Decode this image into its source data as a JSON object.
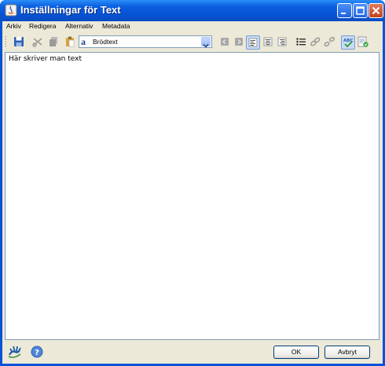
{
  "window": {
    "title": "Inställningar för Text"
  },
  "menu": [
    "Arkiv",
    "Redigera",
    "Alternativ",
    "Metadata"
  ],
  "toolbar": {
    "style_value": "Brödtext"
  },
  "editor": {
    "text": "Här skriver man text"
  },
  "buttons": {
    "ok": "OK",
    "cancel": "Avbryt"
  },
  "icons": [
    "save-icon",
    "cut-icon",
    "copy-icon",
    "paste-icon",
    "style-icon",
    "chevron-down-icon",
    "indent-decrease-icon",
    "indent-increase-icon",
    "align-left-icon",
    "align-center-icon",
    "align-right-icon",
    "bullet-list-icon",
    "link-icon",
    "unlink-icon",
    "spellcheck-icon",
    "spellcheck-options-icon",
    "hand-logo-icon",
    "help-icon",
    "minimize-icon",
    "maximize-icon",
    "close-icon"
  ],
  "colors": {
    "titlebar": "#0654d4",
    "accent": "#316ac5"
  }
}
